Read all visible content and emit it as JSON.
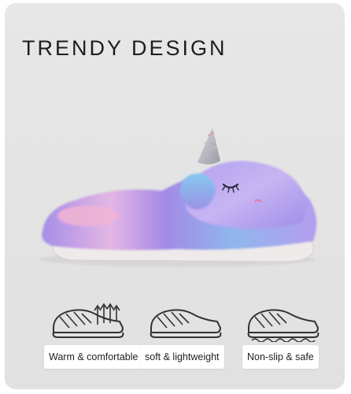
{
  "banner": {
    "headline": "TRENDY DESIGN",
    "background_color": "#e5e5e5"
  },
  "product": {
    "image": "unicorn-plush-slipper",
    "colors": [
      "#a98be8",
      "#8fc3ec",
      "#f4b8d6",
      "#c9c4d8",
      "#eeeaea"
    ]
  },
  "features": [
    {
      "icon": "slipper-breathable-icon",
      "label": "Warm & comfortable"
    },
    {
      "icon": "slipper-lightweight-icon",
      "label": "soft & lightweight"
    },
    {
      "icon": "slipper-nonslip-icon",
      "label": "Non-slip & safe"
    }
  ]
}
